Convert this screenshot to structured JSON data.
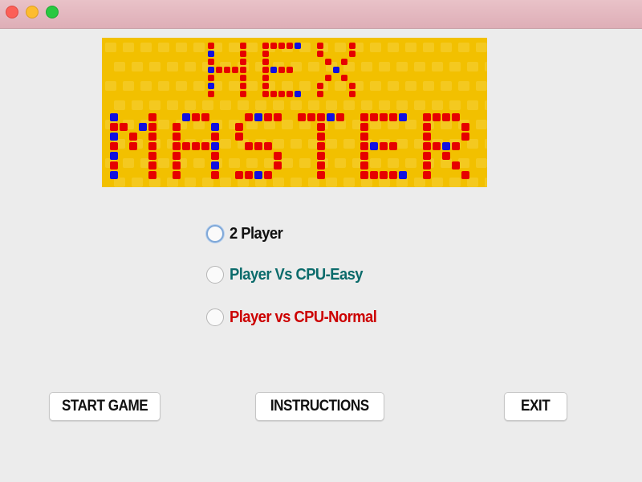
{
  "window": {
    "controls": [
      "close",
      "minimize",
      "maximize"
    ],
    "control_colors": {
      "close": "#fc5f57",
      "minimize": "#fdbc2e",
      "maximize": "#29c840"
    }
  },
  "banner": {
    "logo_text": "HEX MASTER",
    "background_color": "#f2c000",
    "letter_colors": [
      "#e60000",
      "#1010e0"
    ]
  },
  "mode_options": [
    {
      "label": "2 Player",
      "color": "#111111",
      "selected": false,
      "focused": true
    },
    {
      "label": "Player Vs CPU-Easy",
      "color": "#0b6b6b",
      "selected": false,
      "focused": false
    },
    {
      "label": "Player vs CPU-Normal",
      "color": "#cc0000",
      "selected": false,
      "focused": false
    }
  ],
  "buttons": {
    "start": "START GAME",
    "instructions": "INSTRUCTIONS",
    "exit": "EXIT"
  }
}
